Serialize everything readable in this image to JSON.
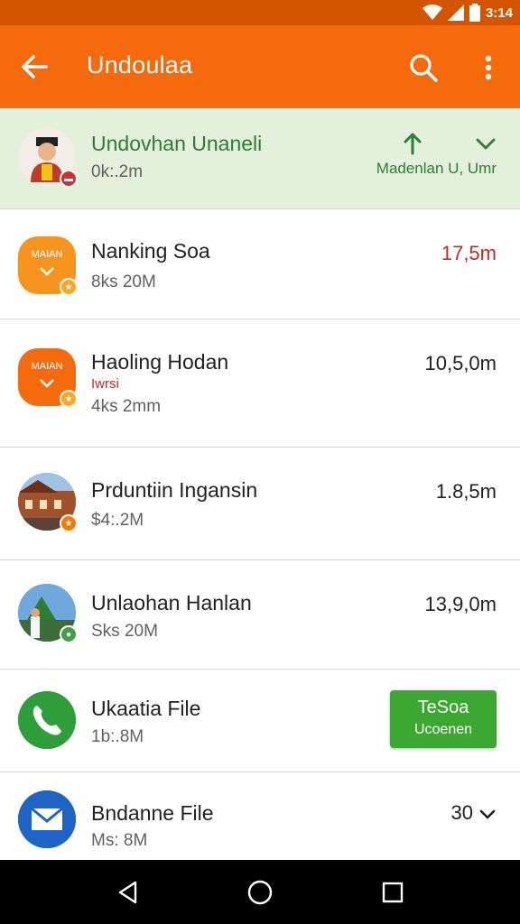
{
  "status": {
    "time": "3:14"
  },
  "app_bar": {
    "title": "Undoulaa",
    "bg_color": "#f46a0d"
  },
  "items": [
    {
      "name": "Undovhan Unaneli",
      "sub": "0k:.2m",
      "status_label": "Madenlan U, Umr",
      "icon": "person-avatar",
      "highlighted": true
    },
    {
      "name": "Nanking Soa",
      "sub": "8ks 20M",
      "size": "17,5m",
      "icon": "orange-app-icon",
      "avatar_text": "MAIAN"
    },
    {
      "name": "Haoling Hodan",
      "extra": "Iwrsi",
      "sub": "4ks 2mm",
      "size": "10,5,0m",
      "icon": "orange-app-icon",
      "avatar_text": "MAIAN"
    },
    {
      "name": "Prduntiin Ingansin",
      "sub": "$4:.2M",
      "size": "1.8,5m",
      "icon": "building-photo-avatar"
    },
    {
      "name": "Unlaohan Hanlan",
      "sub": "Sks 20M",
      "size": "13,9,0m",
      "icon": "landscape-photo-avatar"
    },
    {
      "name": "Ukaatia File",
      "sub": "1b:.8M",
      "icon": "phone-icon",
      "button_line1": "TeSoa",
      "button_line2": "Ucoenen",
      "button_color": "#3aa831"
    },
    {
      "name": "Bndanne File",
      "sub": "Ms: 8M",
      "size": "30",
      "icon": "mail-icon"
    }
  ]
}
